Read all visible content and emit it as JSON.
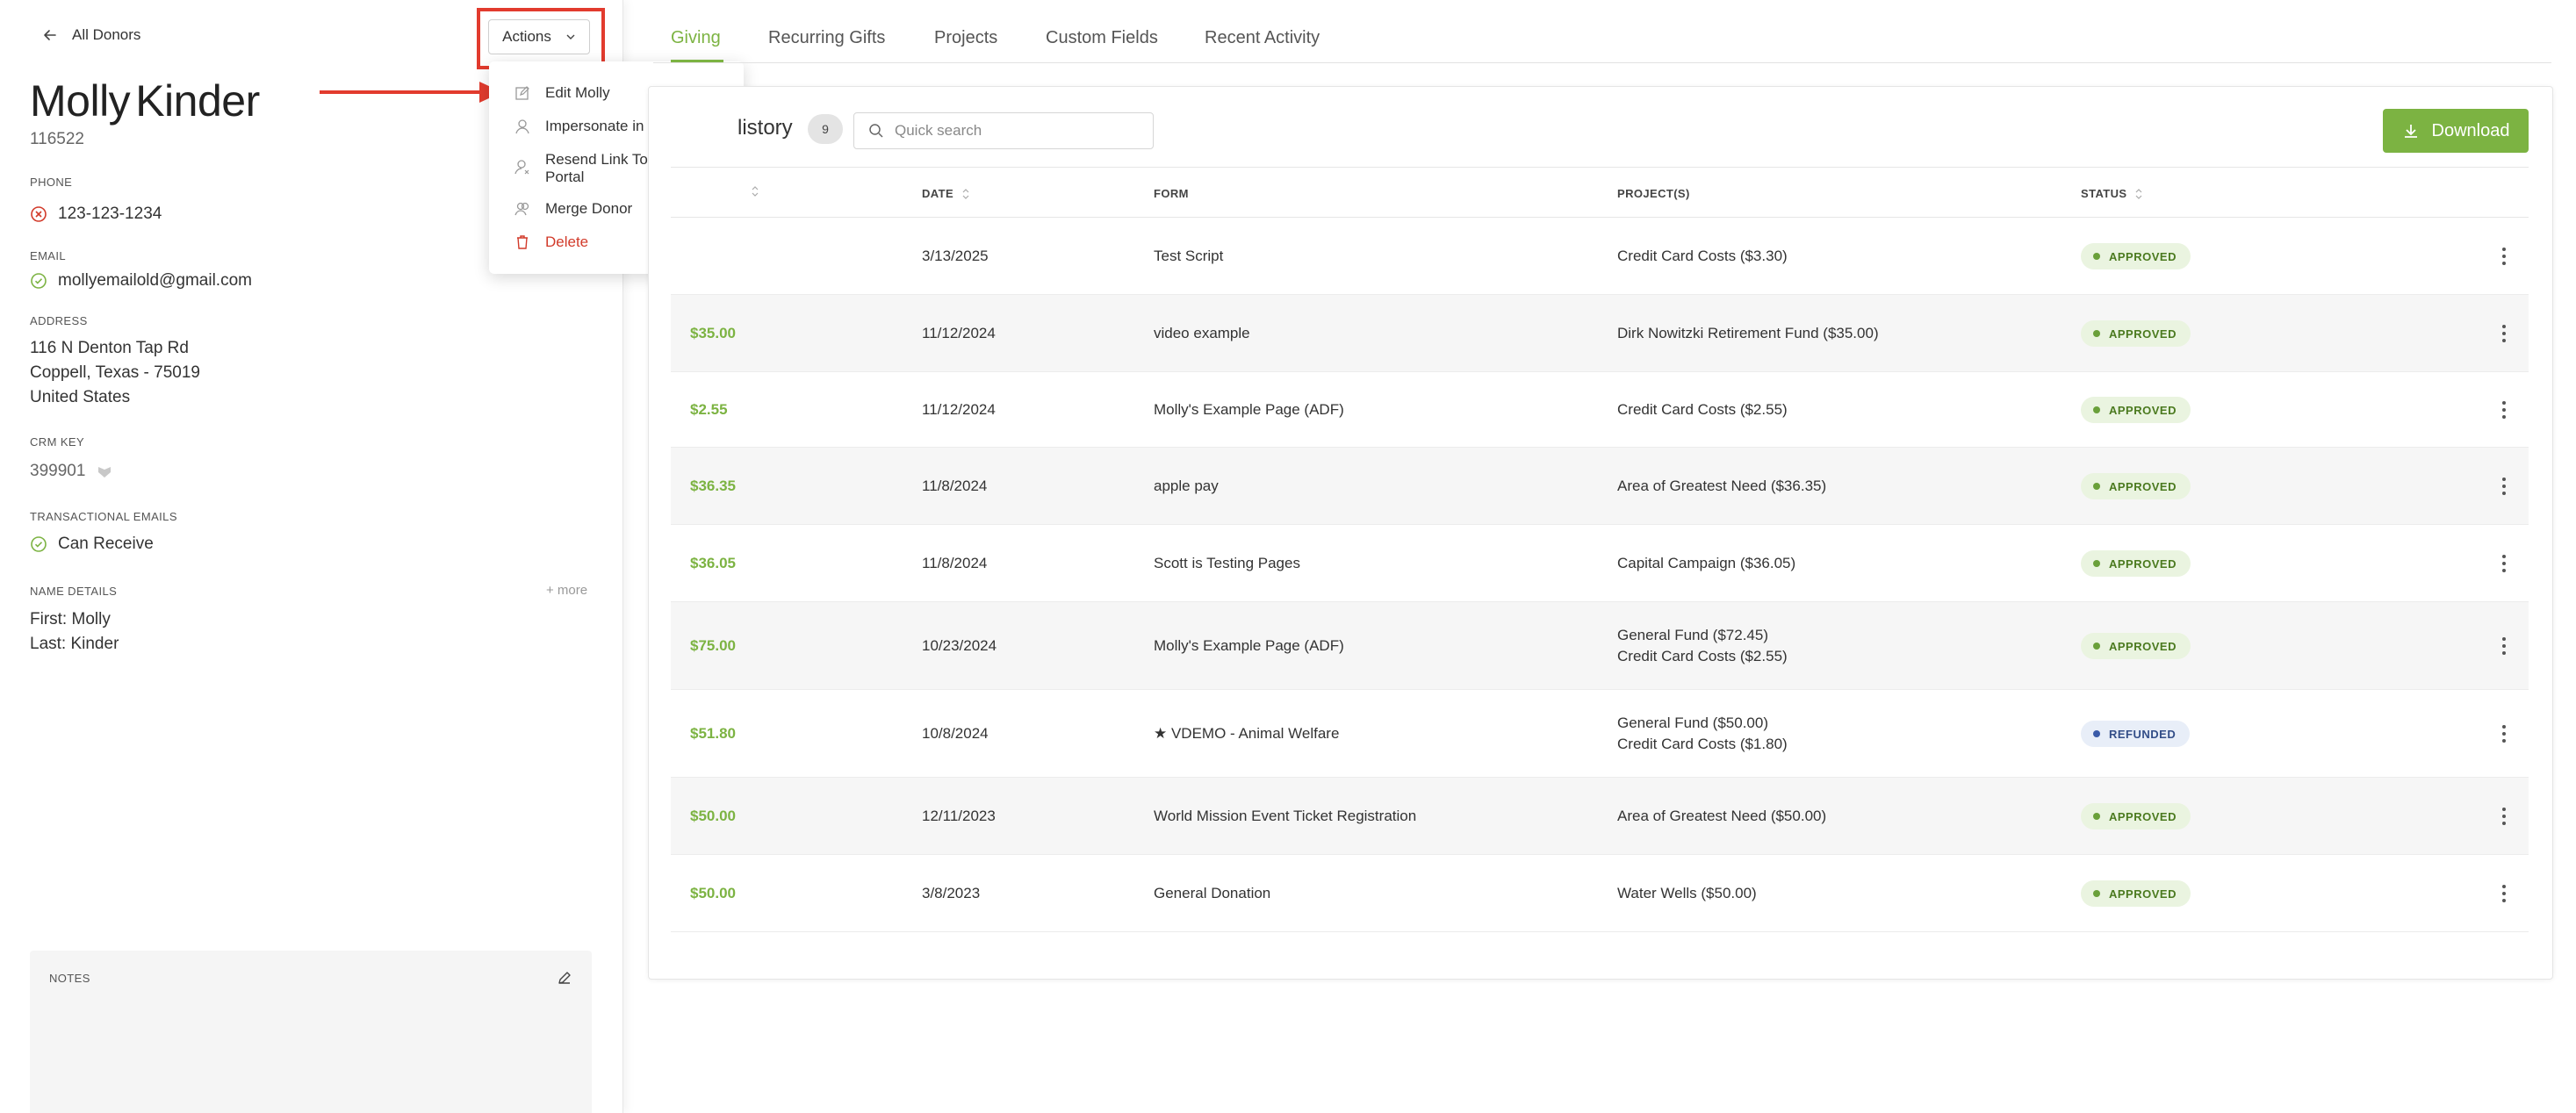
{
  "back_link": "All Donors",
  "actions_label": "Actions",
  "donor": {
    "first_name": "Molly",
    "last_name": "Kinder",
    "id": "116522",
    "phone_label": "PHONE",
    "phone": "123-123-1234",
    "email_label": "EMAIL",
    "email": "mollyemailold@gmail.com",
    "address_label": "ADDRESS",
    "address_line1": "116 N Denton Tap Rd",
    "address_line2": "Coppell, Texas - 75019",
    "address_line3": "United States",
    "crm_label": "CRM KEY",
    "crm_key": "399901",
    "transactional_label": "TRANSACTIONAL EMAILS",
    "transactional_value": "Can Receive",
    "name_details_label": "NAME DETAILS",
    "more_label": "+ more",
    "first_line": "First: Molly",
    "last_line": "Last: Kinder",
    "notes_label": "NOTES"
  },
  "dropdown": {
    "edit": "Edit Molly",
    "impersonate": "Impersonate in Portal",
    "resend_line1": "Resend Link To Donor",
    "resend_line2": "Portal",
    "merge": "Merge Donor",
    "delete": "Delete"
  },
  "tabs": [
    "Giving",
    "Recurring Gifts",
    "Projects",
    "Custom Fields",
    "Recent Activity"
  ],
  "giving": {
    "title": "listory",
    "count": "9",
    "search_placeholder": "Quick search",
    "download_label": "Download",
    "columns": {
      "date": "DATE",
      "form": "FORM",
      "projects": "PROJECT(S)",
      "status": "STATUS"
    },
    "rows": [
      {
        "amount": "",
        "date": "3/13/2025",
        "form": "Test Script",
        "project1": "Credit Card Costs ($3.30)",
        "project2": "",
        "status": "APPROVED"
      },
      {
        "amount": "$35.00",
        "date": "11/12/2024",
        "form": "video example",
        "project1": "Dirk Nowitzki Retirement Fund ($35.00)",
        "project2": "",
        "status": "APPROVED"
      },
      {
        "amount": "$2.55",
        "date": "11/12/2024",
        "form": "Molly's Example Page (ADF)",
        "project1": "Credit Card Costs ($2.55)",
        "project2": "",
        "status": "APPROVED"
      },
      {
        "amount": "$36.35",
        "date": "11/8/2024",
        "form": "apple pay",
        "project1": "Area of Greatest Need ($36.35)",
        "project2": "",
        "status": "APPROVED"
      },
      {
        "amount": "$36.05",
        "date": "11/8/2024",
        "form": "Scott is Testing Pages",
        "project1": "Capital Campaign ($36.05)",
        "project2": "",
        "status": "APPROVED"
      },
      {
        "amount": "$75.00",
        "date": "10/23/2024",
        "form": "Molly's Example Page (ADF)",
        "project1": "General Fund ($72.45)",
        "project2": "Credit Card Costs ($2.55)",
        "status": "APPROVED"
      },
      {
        "amount": "$51.80",
        "date": "10/8/2024",
        "form": "★ VDEMO - Animal Welfare",
        "project1": "General Fund ($50.00)",
        "project2": "Credit Card Costs ($1.80)",
        "status": "REFUNDED"
      },
      {
        "amount": "$50.00",
        "date": "12/11/2023",
        "form": "World Mission Event Ticket Registration",
        "project1": "Area of Greatest Need ($50.00)",
        "project2": "",
        "status": "APPROVED"
      },
      {
        "amount": "$50.00",
        "date": "3/8/2023",
        "form": "General Donation",
        "project1": "Water Wells ($50.00)",
        "project2": "",
        "status": "APPROVED"
      }
    ]
  },
  "colors": {
    "accent_green": "#7cb342",
    "annotation_red": "#e23b2e",
    "delete_red": "#d23a2a",
    "refunded_blue": "#3a5aa8"
  }
}
